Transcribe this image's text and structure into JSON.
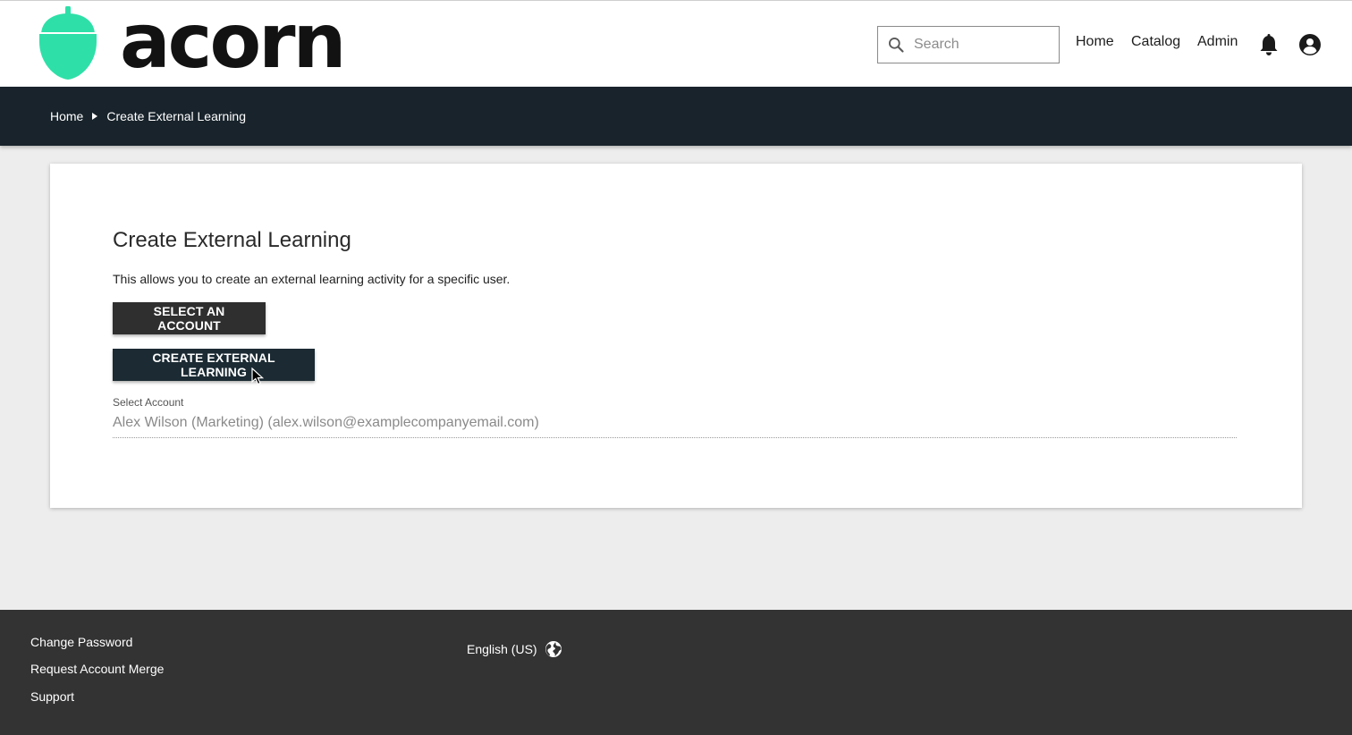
{
  "brand": {
    "name": "acorn",
    "logo_color": "#2ee0a8"
  },
  "header": {
    "search": {
      "placeholder": "Search",
      "value": ""
    },
    "nav": {
      "home": "Home",
      "catalog": "Catalog",
      "admin": "Admin"
    },
    "icons": [
      "search-icon",
      "bell-icon",
      "user-account-icon"
    ]
  },
  "breadcrumb": {
    "items": [
      "Home",
      "Create External Learning"
    ]
  },
  "main": {
    "title": "Create External Learning",
    "description": "This allows you to create an external learning activity for a specific user.",
    "buttons": {
      "select_account": "SELECT AN ACCOUNT",
      "create_external_learning": "CREATE EXTERNAL LEARNING"
    },
    "field": {
      "label": "Select Account",
      "value": "Alex Wilson (Marketing) (alex.wilson@examplecompanyemail.com)"
    }
  },
  "footer": {
    "links": [
      "Change Password",
      "Request Account Merge",
      "Support"
    ],
    "language": "English (US)"
  },
  "colors": {
    "breadcrumb_bar": "#18232b",
    "footer": "#333333",
    "button": "#2f2f2f"
  }
}
